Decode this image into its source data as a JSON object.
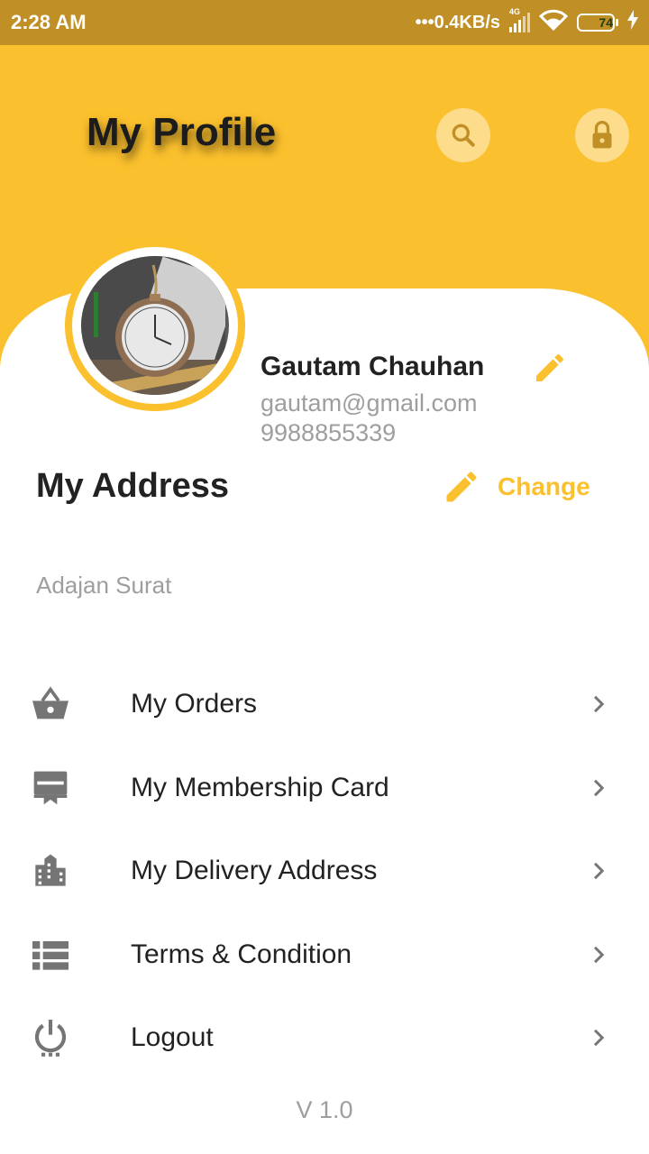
{
  "status_bar": {
    "time": "2:28 AM",
    "network_speed": "•••0.4KB/s",
    "network_type": "4G",
    "battery": "74",
    "battery_fraction": 0.74
  },
  "header": {
    "title": "My Profile",
    "search_icon": "search-icon",
    "lock_icon": "lock-icon"
  },
  "profile": {
    "name": "Gautam Chauhan",
    "email": "gautam@gmail.com",
    "phone": "9988855339"
  },
  "address": {
    "title": "My Address",
    "change_label": "Change",
    "value": "Adajan Surat"
  },
  "menu": {
    "items": [
      {
        "label": "My Orders",
        "icon": "basket-icon"
      },
      {
        "label": "My Membership Card",
        "icon": "card-icon"
      },
      {
        "label": "My Delivery Address",
        "icon": "building-icon"
      },
      {
        "label": "Terms & Condition",
        "icon": "list-icon"
      },
      {
        "label": "Logout",
        "icon": "power-icon"
      }
    ]
  },
  "version": "V 1.0",
  "colors": {
    "primary": "#fbc02d",
    "status_bar": "#c08f25",
    "icon_grey": "#757575",
    "text_grey": "#9e9e9e"
  }
}
